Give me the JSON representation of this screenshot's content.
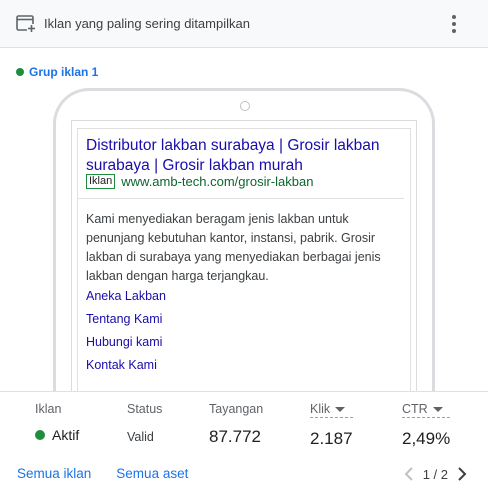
{
  "header": {
    "title": "Iklan yang paling sering ditampilkan"
  },
  "group": {
    "label": "Grup iklan 1"
  },
  "ad": {
    "headline": "Distributor lakban surabaya | Grosir lakban surabaya | Grosir lakban murah",
    "badge": "Iklan",
    "url": "www.amb-tech.com/grosir-lakban",
    "description": "Kami menyediakan beragam jenis lakban untuk penunjang kebutuhan kantor, instansi, pabrik. Grosir lakban di surabaya yang menyediakan berbagai jenis lakban dengan harga terjangkau.",
    "sitelinks": [
      "Aneka Lakban",
      "Tentang Kami",
      "Hubungi kami",
      "Kontak Kami"
    ]
  },
  "stats": {
    "iklan": {
      "label": "Iklan",
      "value": "Aktif"
    },
    "status": {
      "label": "Status",
      "value": "Valid"
    },
    "tayangan": {
      "label": "Tayangan",
      "value": "87.772"
    },
    "klik": {
      "label": "Klik",
      "value": "2.187"
    },
    "ctr": {
      "label": "CTR",
      "value": "2,49%"
    }
  },
  "footer": {
    "all_ads": "Semua iklan",
    "all_assets": "Semua aset",
    "page": "1 / 2"
  },
  "icons": {
    "header": "add-to-window-icon",
    "more": "more-vert-icon",
    "prev": "chevron-left-icon",
    "next": "chevron-right-icon"
  },
  "colors": {
    "accent": "#1a73e8",
    "active": "#1e8e3e",
    "headline": "#1a0dab",
    "url": "#0d652d"
  }
}
